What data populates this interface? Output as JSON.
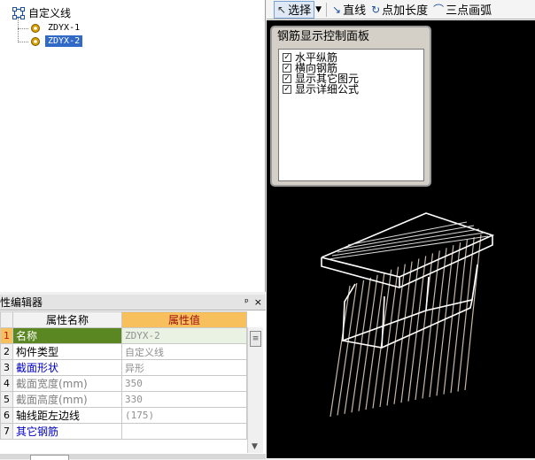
{
  "tree": {
    "root": {
      "label": "自定义线",
      "icon": "frame-icon"
    },
    "children": [
      {
        "label": "ZDYX-1",
        "icon": "gear-icon",
        "selected": false
      },
      {
        "label": "ZDYX-2",
        "icon": "gear-icon",
        "selected": true
      }
    ]
  },
  "property_editor": {
    "title": "性编辑器",
    "pin_glyph": "ᵖ",
    "close_glyph": "×",
    "header_name": "属性名称",
    "header_value": "属性值",
    "rows": [
      {
        "num": "1",
        "name": "名称",
        "value": "ZDYX-2"
      },
      {
        "num": "2",
        "name": "构件类型",
        "value": "自定义线"
      },
      {
        "num": "3",
        "name": "截面形状",
        "value": "异形"
      },
      {
        "num": "4",
        "name": "截面宽度(mm)",
        "value": "350"
      },
      {
        "num": "5",
        "name": "截面高度(mm)",
        "value": "330"
      },
      {
        "num": "6",
        "name": "轴线距左边线",
        "value": "(175)"
      },
      {
        "num": "7",
        "name": "其它钢筋",
        "value": ""
      }
    ]
  },
  "toolbar": {
    "select_label": "选择",
    "line_label": "直线",
    "point_length_label": "点加长度",
    "three_point_label": "三点画弧"
  },
  "rebar_panel": {
    "title": "钢筋显示控制面板",
    "options": [
      {
        "label": "水平纵筋",
        "checked": true
      },
      {
        "label": "横向钢筋",
        "checked": true
      },
      {
        "label": "显示其它图元",
        "checked": true
      },
      {
        "label": "显示详细公式",
        "checked": true
      }
    ]
  },
  "colors": {
    "selection": "#3169c6",
    "highlight_row": "#5b8722",
    "value_header": "#f7c05c",
    "view_background": "#000000"
  }
}
